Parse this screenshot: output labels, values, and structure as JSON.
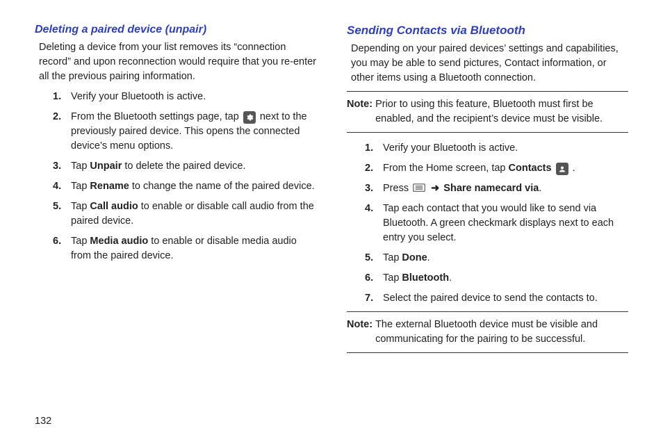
{
  "left": {
    "heading": "Deleting a paired device (unpair)",
    "intro": "Deleting a device from your list removes its “connection record” and upon reconnection would require that you re-enter all the previous pairing information.",
    "steps": [
      {
        "n": "1.",
        "pre": "Verify your Bluetooth is active."
      },
      {
        "n": "2.",
        "pre": "From the Bluetooth settings page, tap ",
        "icon": "gear",
        "post": " next to the previously paired device. This opens the connected device’s menu options."
      },
      {
        "n": "3.",
        "pre": "Tap ",
        "bold": "Unpair",
        "post": " to delete the paired device."
      },
      {
        "n": "4.",
        "pre": "Tap ",
        "bold": "Rename",
        "post": " to change the name of the paired device."
      },
      {
        "n": "5.",
        "pre": "Tap ",
        "bold": "Call audio",
        "post": " to enable or disable call audio from the paired device."
      },
      {
        "n": "6.",
        "pre": "Tap ",
        "bold": "Media audio",
        "post": " to enable or disable media audio from the paired device."
      }
    ]
  },
  "right": {
    "heading": "Sending Contacts via Bluetooth",
    "intro": "Depending on your paired devices’ settings and capabilities, you may be able to send pictures, Contact information, or other items using a Bluetooth connection.",
    "note1": {
      "label": "Note:",
      "body": "Prior to using this feature, Bluetooth must first be enabled, and the recipient’s device must be visible."
    },
    "steps": [
      {
        "n": "1.",
        "pre": "Verify your Bluetooth is active."
      },
      {
        "n": "2.",
        "pre": "From the Home screen, tap ",
        "bold": "Contacts",
        "post_icon": "contacts",
        "tail": " ."
      },
      {
        "n": "3.",
        "pre": "Press ",
        "icon": "menu",
        "arrow": "➜",
        "bold": " Share namecard via",
        "tail": "."
      },
      {
        "n": "4.",
        "pre": "Tap each contact that you would like to send via Bluetooth. A green checkmark displays next to each entry you select."
      },
      {
        "n": "5.",
        "pre": "Tap ",
        "bold": "Done",
        "tail": "."
      },
      {
        "n": "6.",
        "pre": "Tap ",
        "bold": "Bluetooth",
        "tail": "."
      },
      {
        "n": "7.",
        "pre": "Select the paired device to send the contacts to."
      }
    ],
    "note2": {
      "label": "Note:",
      "body": "The external Bluetooth device must be visible and communicating for the pairing to be successful."
    }
  },
  "page_number": "132"
}
